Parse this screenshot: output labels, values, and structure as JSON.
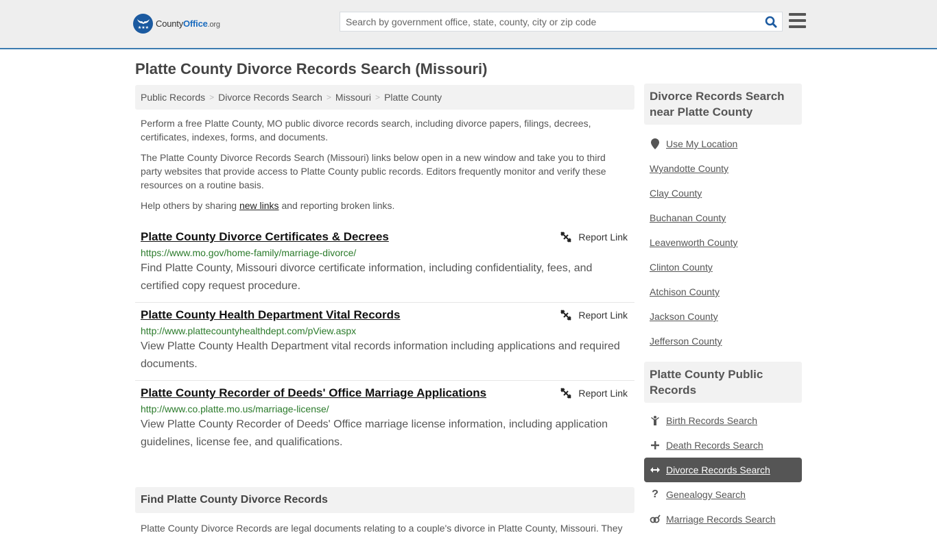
{
  "header": {
    "logo": {
      "name_part1": "County",
      "name_part2": "Office",
      "tld": ".org"
    },
    "search": {
      "placeholder": "Search by government office, state, county, city or zip code",
      "value": ""
    },
    "colors": {
      "accent": "#3b7bb0",
      "logo_blue": "#1b5aa0"
    }
  },
  "page": {
    "title": "Platte County Divorce Records Search (Missouri)"
  },
  "breadcrumb": [
    {
      "label": "Public Records"
    },
    {
      "label": "Divorce Records Search"
    },
    {
      "label": "Missouri"
    },
    {
      "label": "Platte County"
    }
  ],
  "breadcrumb_separator": ">",
  "intro": {
    "p1": "Perform a free Platte County, MO public divorce records search, including divorce papers, filings, decrees, certificates, indexes, forms, and documents.",
    "p2": "The Platte County Divorce Records Search (Missouri) links below open in a new window and take you to third party websites that provide access to Platte County public records. Editors frequently monitor and verify these resources on a routine basis.",
    "p3_before": "Help others by sharing ",
    "p3_link": "new links",
    "p3_after": " and reporting broken links."
  },
  "results": [
    {
      "title": "Platte County Divorce Certificates & Decrees",
      "url": "https://www.mo.gov/home-family/marriage-divorce/",
      "description": "Find Platte County, Missouri divorce certificate information, including confidentiality, fees, and certified copy request procedure.",
      "report_label": "Report Link"
    },
    {
      "title": "Platte County Health Department Vital Records",
      "url": "http://www.plattecountyhealthdept.com/pView.aspx",
      "description": "View Platte County Health Department vital records information including applications and required documents.",
      "report_label": "Report Link"
    },
    {
      "title": "Platte County Recorder of Deeds' Office Marriage Applications",
      "url": "http://www.co.platte.mo.us/marriage-license/",
      "description": "View Platte County Recorder of Deeds' Office marriage license information, including application guidelines, license fee, and qualifications.",
      "report_label": "Report Link"
    }
  ],
  "find_section": {
    "heading": "Find Platte County Divorce Records",
    "body": "Platte County Divorce Records are legal documents relating to a couple's divorce in Platte County, Missouri. They"
  },
  "sidebar": {
    "nearby": {
      "heading": "Divorce Records Search near Platte County",
      "use_location": "Use My Location",
      "counties": [
        "Wyandotte County",
        "Clay County",
        "Buchanan County",
        "Leavenworth County",
        "Clinton County",
        "Atchison County",
        "Jackson County",
        "Jefferson County"
      ]
    },
    "public_records": {
      "heading": "Platte County Public Records",
      "items": [
        {
          "label": "Birth Records Search",
          "icon": "child-icon",
          "active": false
        },
        {
          "label": "Death Records Search",
          "icon": "cross-icon",
          "active": false
        },
        {
          "label": "Divorce Records Search",
          "icon": "arrows-horizontal-icon",
          "active": true
        },
        {
          "label": "Genealogy Search",
          "icon": "question-icon",
          "active": false
        },
        {
          "label": "Marriage Records Search",
          "icon": "gender-icon",
          "active": false
        }
      ]
    }
  }
}
